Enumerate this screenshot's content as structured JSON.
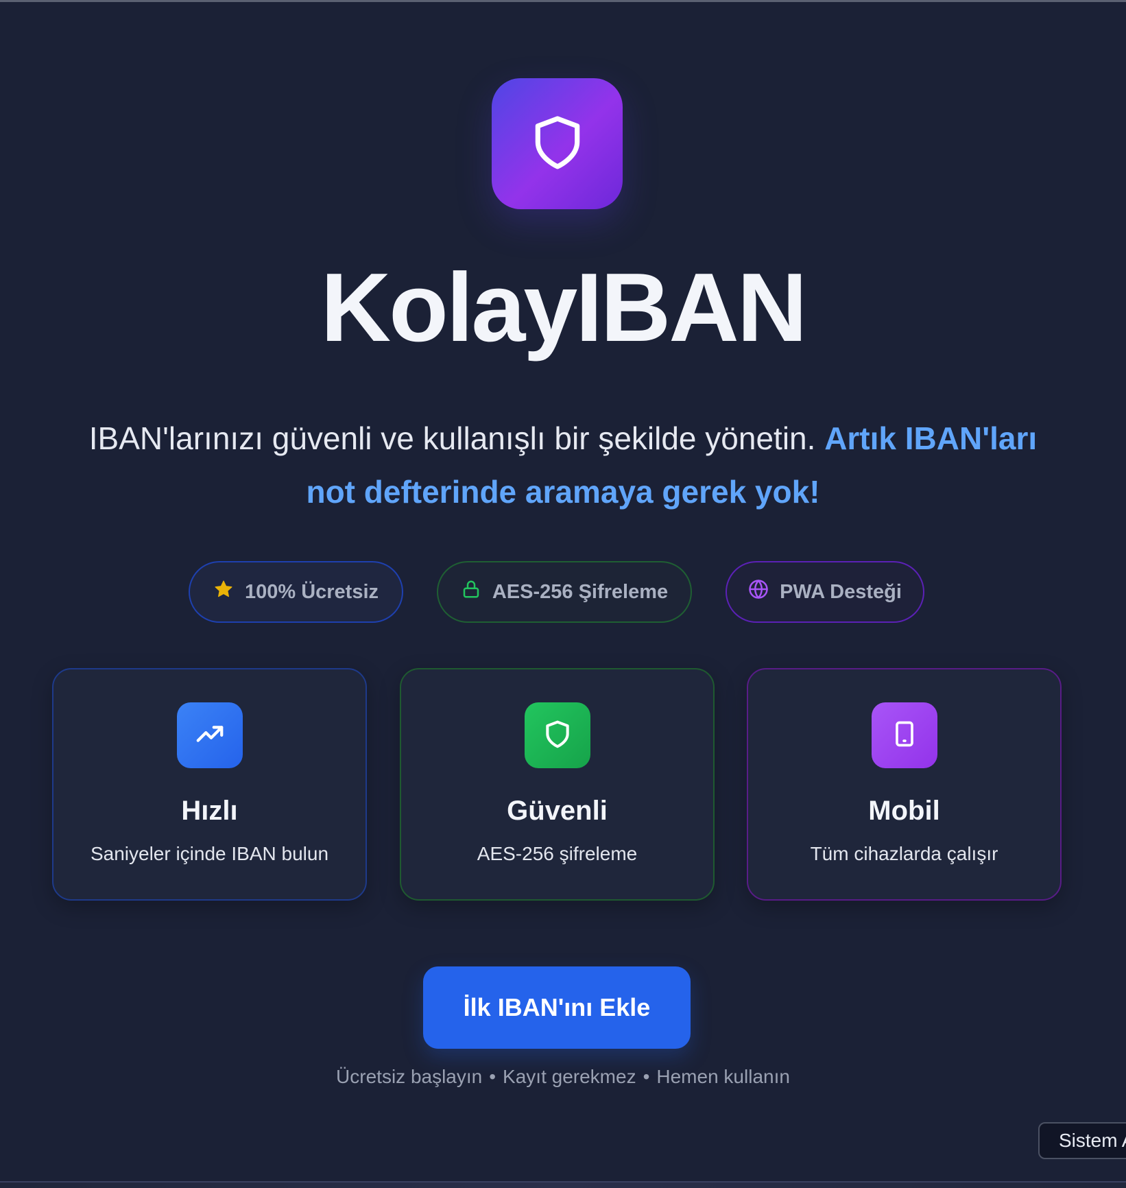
{
  "app": {
    "title": "KolayIBAN"
  },
  "tagline": {
    "main": "IBAN'larınızı güvenli ve kullanışlı bir şekilde yönetin.",
    "highlight": "Artık IBAN'ları not defterinde aramaya gerek yok!"
  },
  "badges": [
    {
      "label": "100% Ücretsiz",
      "icon": "star-icon",
      "color": "#eab308"
    },
    {
      "label": "AES-256 Şifreleme",
      "icon": "lock-icon",
      "color": "#22c55e"
    },
    {
      "label": "PWA Desteği",
      "icon": "globe-icon",
      "color": "#a855f7"
    }
  ],
  "features": [
    {
      "title": "Hızlı",
      "description": "Saniyeler içinde IBAN bulun",
      "icon": "trending-up-icon",
      "accent": "#3b82f6"
    },
    {
      "title": "Güvenli",
      "description": "AES-256 şifreleme",
      "icon": "shield-icon",
      "accent": "#22c55e"
    },
    {
      "title": "Mobil",
      "description": "Tüm cihazlarda çalışır",
      "icon": "tablet-icon",
      "accent": "#a855f7"
    }
  ],
  "cta": {
    "label": "İlk IBAN'ını Ekle"
  },
  "footnote": {
    "items": [
      "Ücretsiz başlayın",
      "Kayıt gerekmez",
      "Hemen kullanın"
    ],
    "separator": "•"
  },
  "system_chip": {
    "label": "Sistem A"
  },
  "colors": {
    "background": "#1b2136",
    "primary": "#2563eb",
    "highlight": "#60a5fa"
  }
}
